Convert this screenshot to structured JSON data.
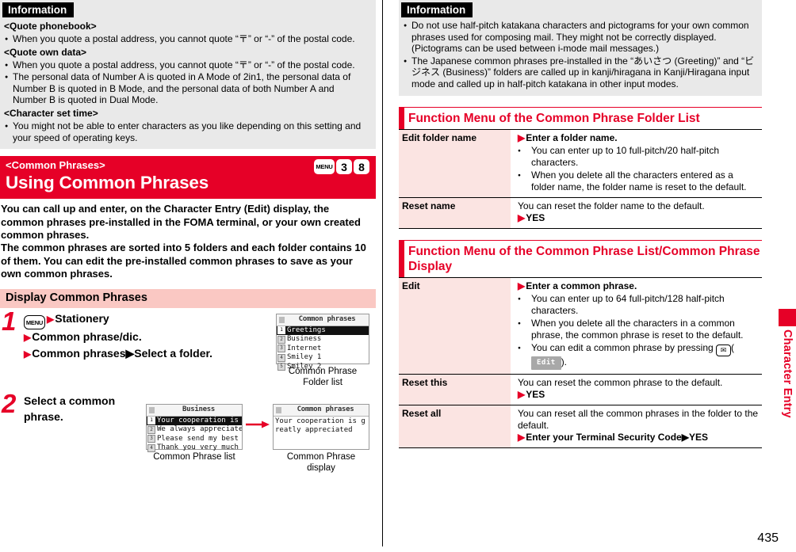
{
  "page": {
    "number": "435",
    "side_tab": "Character Entry"
  },
  "left": {
    "information": {
      "label": "Information",
      "blocks": [
        {
          "heading": "<Quote phonebook>",
          "items": [
            "When you quote a postal address, you cannot quote “〒” or “-” of the postal code."
          ]
        },
        {
          "heading": "<Quote own data>",
          "items": [
            "When you quote a postal address, you cannot quote “〒” or “-” of the postal code.",
            "The personal data of Number A is quoted in A Mode of 2in1, the personal data of Number B is quoted in B Mode, and the personal data of both Number A and Number B is quoted in Dual Mode."
          ]
        },
        {
          "heading": "<Character set time>",
          "items": [
            "You might not be able to enter characters as you like depending on this setting and your speed of operating keys."
          ]
        }
      ]
    },
    "banner": {
      "kicker": "<Common Phrases>",
      "title": "Using Common Phrases",
      "keys": [
        "MENU",
        "3",
        "8"
      ]
    },
    "intro": [
      "You can call up and enter, on the Character Entry (Edit) display, the common phrases pre-installed in the FOMA terminal, or your own created common phrases.",
      "The common phrases are sorted into 5 folders and each folder contains 10 of them. You can edit the pre-installed common phrases to save as your own common phrases."
    ],
    "subsection": {
      "title": "Display Common Phrases"
    },
    "steps": [
      {
        "num": "1",
        "key": "MENU",
        "lines": [
          "Stationery",
          "Common phrase/dic.",
          "Common phrases▶Select a folder."
        ]
      },
      {
        "num": "2",
        "key": "",
        "lines": [
          "Select a common phrase."
        ]
      }
    ],
    "screens": {
      "folder_list": {
        "title": "Common phrases",
        "caption": "Common Phrase Folder list",
        "rows": [
          {
            "idx": "1",
            "text": "Greetings",
            "selected": true
          },
          {
            "idx": "2",
            "text": "Business",
            "selected": false
          },
          {
            "idx": "3",
            "text": "Internet",
            "selected": false
          },
          {
            "idx": "4",
            "text": "Smiley 1",
            "selected": false
          },
          {
            "idx": "5",
            "text": "Smiley 2",
            "selected": false
          }
        ]
      },
      "phrase_list": {
        "title": "Business",
        "caption": "Common Phrase list",
        "rows": [
          {
            "idx": "1",
            "text": "Your cooperation is gr",
            "selected": true
          },
          {
            "idx": "2",
            "text": "We always appreciate y",
            "selected": false
          },
          {
            "idx": "3",
            "text": "Please send my best re",
            "selected": false
          },
          {
            "idx": "4",
            "text": "Thank you very much fo",
            "selected": false
          }
        ]
      },
      "phrase_display": {
        "title": "Common phrases",
        "caption": "Common Phrase display",
        "body": "Your cooperation is greatly appreciated"
      }
    }
  },
  "right": {
    "information": {
      "label": "Information",
      "items": [
        "Do not use half-pitch katakana characters and pictograms for your own common phrases used for composing mail. They might not be correctly displayed. (Pictograms can be used between i-mode mail messages.)",
        "The Japanese common phrases pre-installed in the “あいさつ (Greeting)” and “ビジネス (Business)” folders are called up in kanji/hiragana in Kanji/Hiragana input mode and called up in half-pitch katakana in other input modes."
      ]
    },
    "sections": [
      {
        "title": "Function Menu of the Common Phrase Folder List",
        "rows": [
          {
            "key": "Edit folder name",
            "action": "Enter a folder name.",
            "lead": "",
            "bullets": [
              "You can enter up to 10 full-pitch/20 half-pitch characters.",
              "When you delete all the characters entered as a folder name, the folder name is reset to the default."
            ],
            "after": ""
          },
          {
            "key": "Reset name",
            "action": "YES",
            "lead": "You can reset the folder name to the default.",
            "bullets": [],
            "after": ""
          }
        ]
      },
      {
        "title": "Function Menu of the Common Phrase List/Common Phrase Display",
        "rows": [
          {
            "key": "Edit",
            "action": "Enter a common phrase.",
            "lead": "",
            "bullets": [
              "You can enter up to 64 full-pitch/128 half-pitch characters.",
              "When you delete all the characters in a common phrase, the common phrase is reset to the default."
            ],
            "after": "You can edit a common phrase by pressing",
            "after_key": "✉",
            "after_btn": "Edit"
          },
          {
            "key": "Reset this",
            "action": "YES",
            "lead": "You can reset the common phrase to the default.",
            "bullets": [],
            "after": ""
          },
          {
            "key": "Reset all",
            "action": "Enter your Terminal Security Code▶YES",
            "lead": "You can reset all the common phrases in the folder to the default.",
            "bullets": [],
            "after": ""
          }
        ]
      }
    ]
  }
}
